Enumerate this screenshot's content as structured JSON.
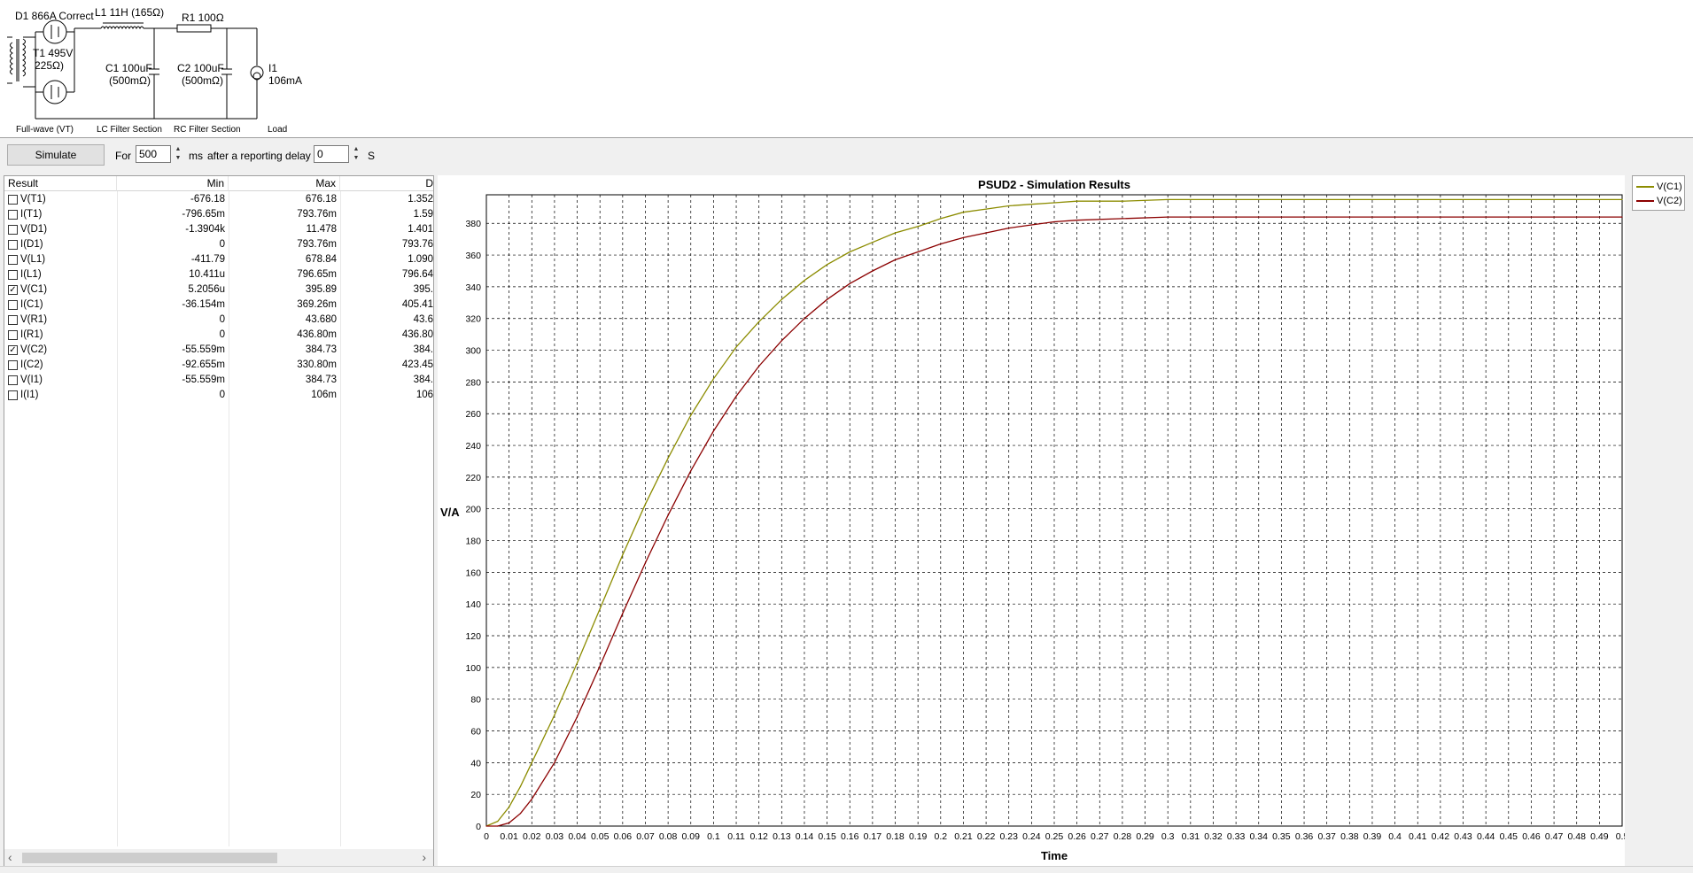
{
  "schematic": {
    "d1_label": "D1 866A Correct",
    "l1_label": "L1 11H (165Ω)",
    "r1_label": "R1 100Ω",
    "t1_voltage": "T1 495V",
    "t1_resistance": "225Ω)",
    "c1_value": "C1 100uF",
    "c1_esr": "(500mΩ)",
    "c2_value": "C2 100uF",
    "c2_esr": "(500mΩ)",
    "i1_name": "I1",
    "i1_value": "106mA",
    "section_rectifier": "Full-wave (VT)",
    "section_lc": "LC Filter Section",
    "section_rc": "RC Filter Section",
    "section_load": "Load"
  },
  "toolbar": {
    "simulate_label": "Simulate",
    "for_label": "For",
    "duration_value": "500",
    "ms_label": "ms",
    "delay_label": "after a reporting delay of",
    "delay_value": "0",
    "s_label": "S"
  },
  "results": {
    "headers": [
      "Result",
      "Min",
      "Max",
      "D"
    ],
    "rows": [
      {
        "name": "V(T1)",
        "checked": false,
        "min": "-676.18",
        "max": "676.18",
        "d": "1.352"
      },
      {
        "name": "I(T1)",
        "checked": false,
        "min": "-796.65m",
        "max": "793.76m",
        "d": "1.59"
      },
      {
        "name": "V(D1)",
        "checked": false,
        "min": "-1.3904k",
        "max": "11.478",
        "d": "1.401"
      },
      {
        "name": "I(D1)",
        "checked": false,
        "min": "0",
        "max": "793.76m",
        "d": "793.76"
      },
      {
        "name": "V(L1)",
        "checked": false,
        "min": "-411.79",
        "max": "678.84",
        "d": "1.090"
      },
      {
        "name": "I(L1)",
        "checked": false,
        "min": "10.411u",
        "max": "796.65m",
        "d": "796.64"
      },
      {
        "name": "V(C1)",
        "checked": true,
        "min": "5.2056u",
        "max": "395.89",
        "d": "395."
      },
      {
        "name": "I(C1)",
        "checked": false,
        "min": "-36.154m",
        "max": "369.26m",
        "d": "405.41"
      },
      {
        "name": "V(R1)",
        "checked": false,
        "min": "0",
        "max": "43.680",
        "d": "43.6"
      },
      {
        "name": "I(R1)",
        "checked": false,
        "min": "0",
        "max": "436.80m",
        "d": "436.80"
      },
      {
        "name": "V(C2)",
        "checked": true,
        "min": "-55.559m",
        "max": "384.73",
        "d": "384."
      },
      {
        "name": "I(C2)",
        "checked": false,
        "min": "-92.655m",
        "max": "330.80m",
        "d": "423.45"
      },
      {
        "name": "V(I1)",
        "checked": false,
        "min": "-55.559m",
        "max": "384.73",
        "d": "384."
      },
      {
        "name": "I(I1)",
        "checked": false,
        "min": "0",
        "max": "106m",
        "d": "106"
      }
    ]
  },
  "chart_data": {
    "type": "line",
    "title": "PSUD2 - Simulation Results",
    "xlabel": "Time",
    "ylabel": "V/A",
    "xlim": [
      0,
      0.5
    ],
    "ylim": [
      0,
      395
    ],
    "grid": true,
    "legend_position": "top-right, outside plot",
    "x_ticks": [
      "0",
      "0.01",
      "0.02",
      "0.03",
      "0.04",
      "0.05",
      "0.06",
      "0.07",
      "0.08",
      "0.09",
      "0.1",
      "0.11",
      "0.12",
      "0.13",
      "0.14",
      "0.15",
      "0.16",
      "0.17",
      "0.18",
      "0.19",
      "0.2",
      "0.21",
      "0.22",
      "0.23",
      "0.24",
      "0.25",
      "0.26",
      "0.27",
      "0.28",
      "0.29",
      "0.3",
      "0.31",
      "0.32",
      "0.33",
      "0.34",
      "0.35",
      "0.36",
      "0.37",
      "0.38",
      "0.39",
      "0.4",
      "0.41",
      "0.42",
      "0.43",
      "0.44",
      "0.45",
      "0.46",
      "0.47",
      "0.48",
      "0.49",
      "0.5"
    ],
    "y_ticks": [
      "0",
      "20",
      "40",
      "60",
      "80",
      "100",
      "120",
      "140",
      "160",
      "180",
      "200",
      "220",
      "240",
      "260",
      "280",
      "300",
      "320",
      "340",
      "360",
      "380"
    ],
    "series": [
      {
        "name": "V(C1)",
        "color": "#8c8c00",
        "x": [
          0,
          0.005,
          0.01,
          0.015,
          0.02,
          0.03,
          0.04,
          0.05,
          0.06,
          0.07,
          0.08,
          0.09,
          0.1,
          0.11,
          0.12,
          0.13,
          0.14,
          0.15,
          0.16,
          0.17,
          0.18,
          0.19,
          0.2,
          0.21,
          0.22,
          0.23,
          0.24,
          0.25,
          0.26,
          0.28,
          0.3,
          0.35,
          0.4,
          0.45,
          0.5
        ],
        "y": [
          0,
          3,
          12,
          25,
          40,
          70,
          103,
          137,
          171,
          203,
          232,
          259,
          282,
          302,
          318,
          332,
          344,
          354,
          362,
          368,
          374,
          378,
          383,
          387,
          389,
          391,
          392,
          393,
          394,
          394,
          395,
          395,
          395,
          395,
          395
        ]
      },
      {
        "name": "V(C2)",
        "color": "#8b0000",
        "x": [
          0,
          0.005,
          0.01,
          0.015,
          0.02,
          0.03,
          0.04,
          0.05,
          0.06,
          0.07,
          0.08,
          0.09,
          0.1,
          0.11,
          0.12,
          0.13,
          0.14,
          0.15,
          0.16,
          0.17,
          0.18,
          0.19,
          0.2,
          0.21,
          0.22,
          0.23,
          0.24,
          0.25,
          0.26,
          0.28,
          0.3,
          0.35,
          0.4,
          0.45,
          0.5
        ],
        "y": [
          0,
          0,
          2,
          8,
          17,
          40,
          69,
          101,
          134,
          166,
          196,
          224,
          249,
          271,
          290,
          306,
          320,
          332,
          342,
          350,
          357,
          362,
          367,
          371,
          374,
          377,
          379,
          381,
          382,
          383,
          384,
          384,
          384,
          384,
          384
        ]
      }
    ]
  }
}
